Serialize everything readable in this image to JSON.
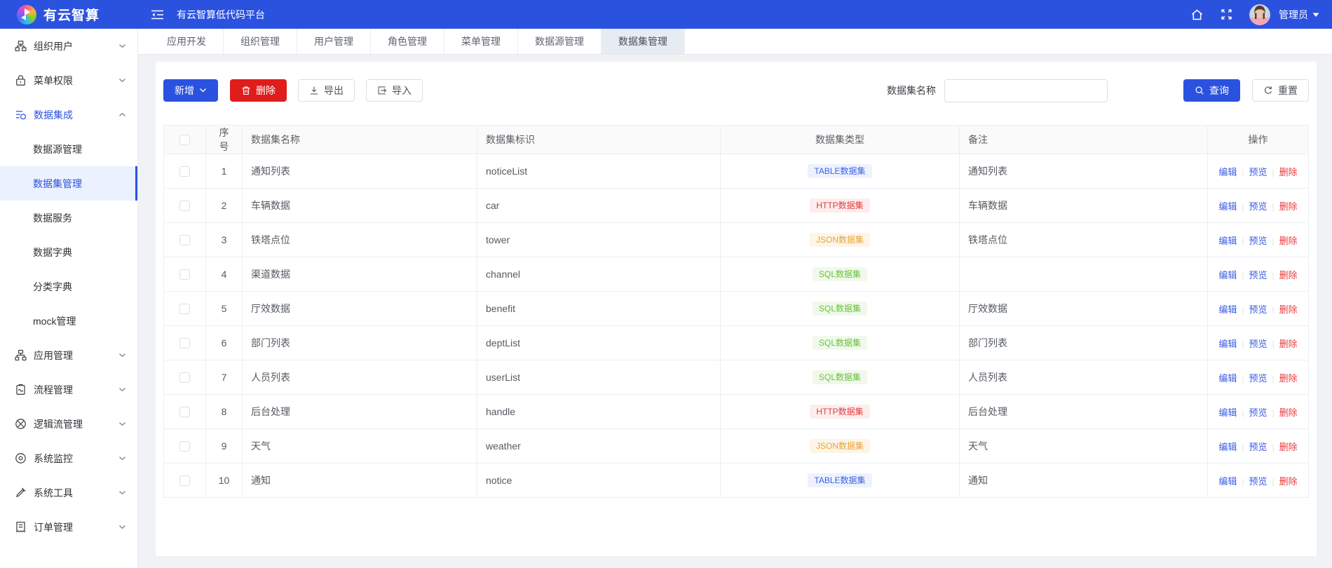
{
  "topbar": {
    "brand": "有云智算",
    "app_title": "有云智算低代码平台",
    "user_name": "管理员"
  },
  "tabs": [
    {
      "label": "应用开发",
      "active": false
    },
    {
      "label": "组织管理",
      "active": false
    },
    {
      "label": "用户管理",
      "active": false
    },
    {
      "label": "角色管理",
      "active": false
    },
    {
      "label": "菜单管理",
      "active": false
    },
    {
      "label": "数据源管理",
      "active": false
    },
    {
      "label": "数据集管理",
      "active": true
    }
  ],
  "sidebar": {
    "items": [
      {
        "label": "组织用户",
        "icon": "org-icon",
        "expanded": false,
        "active": false
      },
      {
        "label": "菜单权限",
        "icon": "lock-icon",
        "expanded": false,
        "active": false
      },
      {
        "label": "数据集成",
        "icon": "data-integration-icon",
        "expanded": true,
        "active": true,
        "children": [
          {
            "label": "数据源管理",
            "active": false
          },
          {
            "label": "数据集管理",
            "active": true
          },
          {
            "label": "数据服务",
            "active": false
          },
          {
            "label": "数据字典",
            "active": false
          },
          {
            "label": "分类字典",
            "active": false
          },
          {
            "label": "mock管理",
            "active": false
          }
        ]
      },
      {
        "label": "应用管理",
        "icon": "app-icon",
        "expanded": false,
        "active": false
      },
      {
        "label": "流程管理",
        "icon": "process-icon",
        "expanded": false,
        "active": false
      },
      {
        "label": "逻辑流管理",
        "icon": "logicflow-icon",
        "expanded": false,
        "active": false
      },
      {
        "label": "系统监控",
        "icon": "monitor-icon",
        "expanded": false,
        "active": false
      },
      {
        "label": "系统工具",
        "icon": "tools-icon",
        "expanded": false,
        "active": false
      },
      {
        "label": "订单管理",
        "icon": "order-icon",
        "expanded": false,
        "active": false
      }
    ]
  },
  "toolbar": {
    "add_label": "新增",
    "delete_label": "删除",
    "export_label": "导出",
    "import_label": "导入",
    "search_label": "数据集名称",
    "search_value": "",
    "query_label": "查询",
    "reset_label": "重置"
  },
  "table": {
    "columns": [
      "序号",
      "数据集名称",
      "数据集标识",
      "数据集类型",
      "备注",
      "操作"
    ],
    "action_labels": [
      "编辑",
      "预览",
      "删除"
    ],
    "rows": [
      {
        "no": "1",
        "name": "通知列表",
        "code": "noticeList",
        "type": "TABLE数据集",
        "type_kind": "table",
        "remark": "通知列表"
      },
      {
        "no": "2",
        "name": "车辆数据",
        "code": "car",
        "type": "HTTP数据集",
        "type_kind": "http",
        "remark": "车辆数据"
      },
      {
        "no": "3",
        "name": "铁塔点位",
        "code": "tower",
        "type": "JSON数据集",
        "type_kind": "json",
        "remark": "铁塔点位"
      },
      {
        "no": "4",
        "name": "渠道数据",
        "code": "channel",
        "type": "SQL数据集",
        "type_kind": "sql",
        "remark": ""
      },
      {
        "no": "5",
        "name": "厅效数据",
        "code": "benefit",
        "type": "SQL数据集",
        "type_kind": "sql",
        "remark": "厅效数据"
      },
      {
        "no": "6",
        "name": "部门列表",
        "code": "deptList",
        "type": "SQL数据集",
        "type_kind": "sql",
        "remark": "部门列表"
      },
      {
        "no": "7",
        "name": "人员列表",
        "code": "userList",
        "type": "SQL数据集",
        "type_kind": "sql",
        "remark": "人员列表"
      },
      {
        "no": "8",
        "name": "后台处理",
        "code": "handle",
        "type": "HTTP数据集",
        "type_kind": "http",
        "remark": "后台处理"
      },
      {
        "no": "9",
        "name": "天气",
        "code": "weather",
        "type": "JSON数据集",
        "type_kind": "json",
        "remark": "天气"
      },
      {
        "no": "10",
        "name": "通知",
        "code": "notice",
        "type": "TABLE数据集",
        "type_kind": "table",
        "remark": "通知"
      }
    ]
  },
  "colors": {
    "primary": "#2b52df",
    "danger": "#e11c1c",
    "content_bg": "#f0f2f5",
    "active_menu_bg": "#ebf1fe",
    "tag_table_fg": "#3e61e4",
    "tag_table_bg": "#eef2fd",
    "tag_http_fg": "#e73c3c",
    "tag_http_bg": "#fdeded",
    "tag_json_fg": "#eea236",
    "tag_json_bg": "#fdf5e7",
    "tag_sql_fg": "#67c23a",
    "tag_sql_bg": "#f0f9eb"
  }
}
